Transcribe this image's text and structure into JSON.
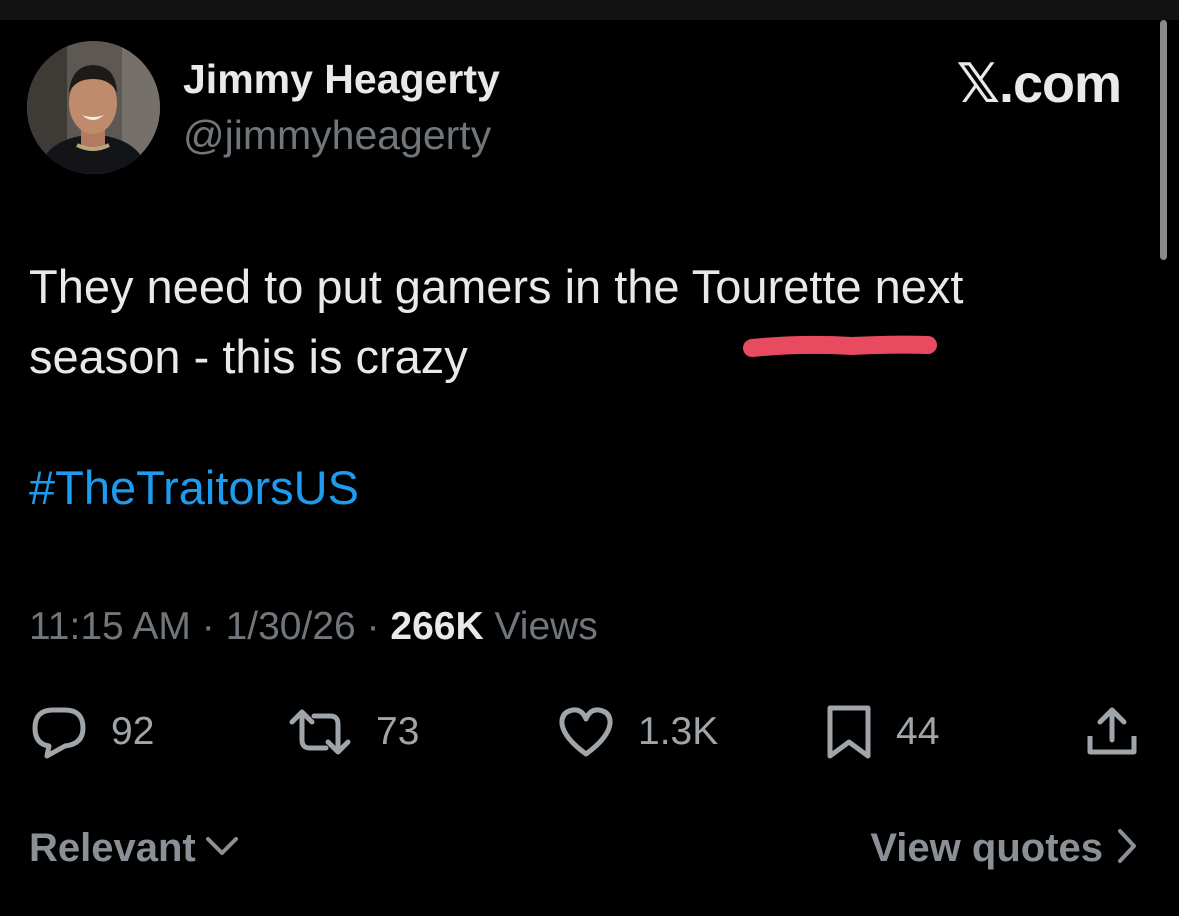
{
  "author": {
    "name": "Jimmy Heagerty",
    "handle": "@jimmyheagerty"
  },
  "site": {
    "watermark": "𝕏.com"
  },
  "tweet": {
    "line1": "They need to put gamers in the Tourette next",
    "line2": "season - this is crazy",
    "hashtag": "#TheTraitorsUS"
  },
  "meta": {
    "time": "11:15 AM",
    "separator": "·",
    "date": "1/30/26",
    "views_count": "266K",
    "views_label": "Views"
  },
  "actions": {
    "replies": "92",
    "reposts": "73",
    "likes": "1.3K",
    "bookmarks": "44"
  },
  "footer": {
    "sort_label": "Relevant",
    "quotes_label": "View quotes"
  },
  "colors": {
    "background": "#000000",
    "text": "#e7e9ea",
    "muted": "#71767b",
    "link": "#1d9bf0",
    "highlight_stroke": "#e84a5f"
  },
  "icons": {
    "reply": "speech-bubble-icon",
    "repost": "repost-arrows-icon",
    "like": "heart-icon",
    "bookmark": "bookmark-icon",
    "share": "share-upload-icon",
    "sort": "chevron-down-icon",
    "quotes": "chevron-right-icon"
  }
}
